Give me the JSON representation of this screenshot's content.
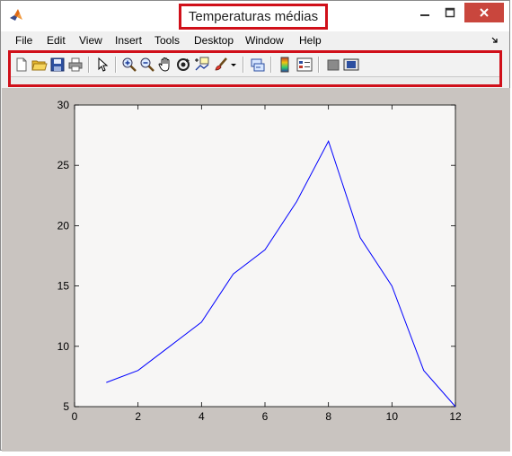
{
  "window": {
    "title": "Temperaturas médias",
    "controls": [
      "minimize",
      "maximize",
      "close"
    ]
  },
  "menu": {
    "items": [
      {
        "label": "File"
      },
      {
        "label": "Edit"
      },
      {
        "label": "View"
      },
      {
        "label": "Insert"
      },
      {
        "label": "Tools"
      },
      {
        "label": "Desktop"
      },
      {
        "label": "Window"
      },
      {
        "label": "Help"
      }
    ]
  },
  "toolbar": {
    "icons": [
      "new-figure-icon",
      "open-file-icon",
      "save-icon",
      "print-icon",
      "pointer-icon",
      "zoom-in-icon",
      "zoom-out-icon",
      "pan-hand-icon",
      "rotate-3d-icon",
      "data-cursor-icon",
      "brush-icon",
      "link-plot-icon",
      "colorbar-icon",
      "legend-icon",
      "hide-plot-tools-icon",
      "show-plot-tools-icon"
    ]
  },
  "chart_data": {
    "type": "line",
    "title": "",
    "xlabel": "",
    "ylabel": "",
    "xlim": [
      0,
      12
    ],
    "ylim": [
      5,
      30
    ],
    "xticks": [
      "0",
      "2",
      "4",
      "6",
      "8",
      "10",
      "12"
    ],
    "yticks": [
      "5",
      "10",
      "15",
      "20",
      "25",
      "30"
    ],
    "grid": false,
    "line_color": "#0000ff",
    "series": [
      {
        "x": [
          1,
          2,
          3,
          4,
          5,
          6,
          7,
          8,
          9,
          10,
          11,
          12
        ],
        "y": [
          7,
          8,
          10,
          12,
          16,
          18,
          22,
          27,
          19,
          15,
          8,
          5
        ]
      }
    ]
  }
}
